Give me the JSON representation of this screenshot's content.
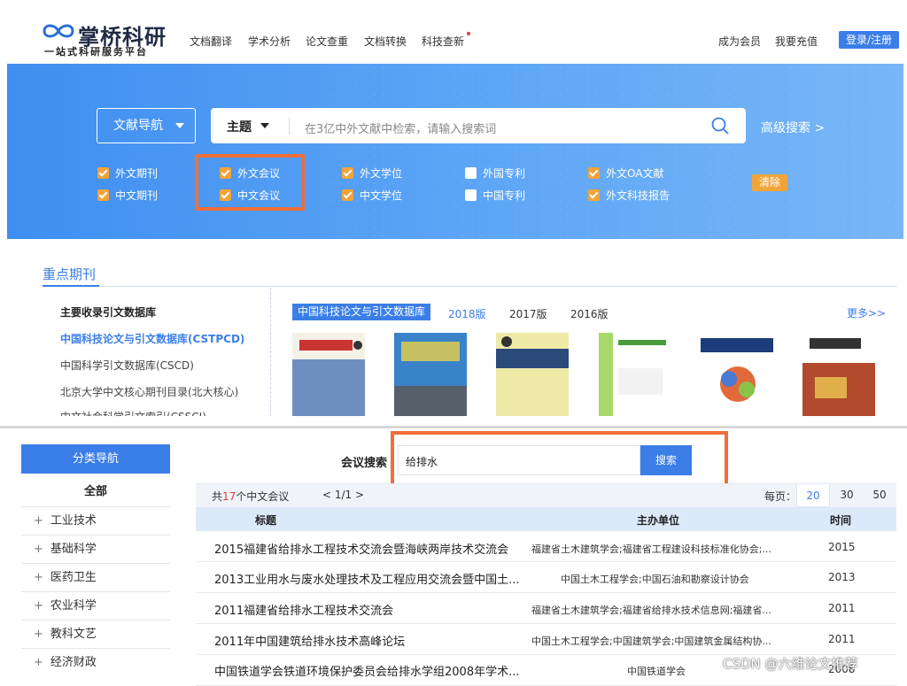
{
  "header": {
    "logo_title": "掌桥科研",
    "logo_sub": "一站式科研服务平台",
    "nav": [
      "文档翻译",
      "学术分析",
      "论文查重",
      "文档转换",
      "科技查新"
    ],
    "member": "成为会员",
    "recharge": "我要充值",
    "login": "登录/注册"
  },
  "hero": {
    "nav_button": "文献导航",
    "search_type": "主题",
    "search_placeholder": "在3亿中外文献中检索，请输入搜索词",
    "advanced": "高级搜索 >",
    "filters_row1": [
      {
        "label": "外文期刊",
        "checked": true
      },
      {
        "label": "外文会议",
        "checked": true
      },
      {
        "label": "外文学位",
        "checked": true
      },
      {
        "label": "外国专利",
        "checked": false
      },
      {
        "label": "外文OA文献",
        "checked": true
      }
    ],
    "filters_row2": [
      {
        "label": "中文期刊",
        "checked": true
      },
      {
        "label": "中文会议",
        "checked": true
      },
      {
        "label": "中文学位",
        "checked": true
      },
      {
        "label": "中国专利",
        "checked": false
      },
      {
        "label": "外文科技报告",
        "checked": true
      }
    ],
    "clear": "清除"
  },
  "journals": {
    "title": "重点期刊",
    "left_head": "主要收录引文数据库",
    "left_items": [
      "中国科技论文与引文数据库(CSTPCD)",
      "中国科学引文数据库(CSCD)",
      "北京大学中文核心期刊目录(北大核心)",
      "中文社会科学引文索引(CSSCI)"
    ],
    "active_tab": "中国科技论文与引文数据库",
    "years": [
      "2018版",
      "2017版",
      "2016版"
    ],
    "more": "更多>>"
  },
  "bottom": {
    "category_title": "分类导航",
    "category_all": "全部",
    "categories": [
      "工业技术",
      "基础科学",
      "医药卫生",
      "农业科学",
      "教科文艺",
      "经济财政"
    ],
    "conference_label": "会议搜索",
    "query": "给排水",
    "search_button": "搜索",
    "result_prefix": "共",
    "result_count": "17",
    "result_suffix": "个中文会议",
    "page_info": "< 1/1 >",
    "per_page_label": "每页：",
    "per_page": [
      "20",
      "30",
      "50"
    ],
    "columns": [
      "标题",
      "主办单位",
      "时间"
    ],
    "rows": [
      {
        "title": "2015福建省给排水工程技术交流会暨海峡两岸技术交流会",
        "org": "福建省土木建筑学会;福建省工程建设科技标准化协会;...",
        "year": "2015"
      },
      {
        "title": "2013工业用水与废水处理技术及工程应用交流会暨中国土...",
        "org": "中国土木工程学会;中国石油和勘察设计协会",
        "year": "2013"
      },
      {
        "title": "2011福建省给排水工程技术交流会",
        "org": "福建省土木建筑学会;福建省给排水技术信息网;福建省...",
        "year": "2011"
      },
      {
        "title": "2011年中国建筑给排水技术高峰论坛",
        "org": "中国土木工程学会;中国建筑学会;中国建筑金属结构协...",
        "year": "2011"
      },
      {
        "title": "中国铁道学会铁道环境保护委员会给排水学组2008年学术...",
        "org": "中国铁道学会",
        "year": "2008"
      }
    ]
  },
  "watermark": "CSDN @六维论文推荐"
}
